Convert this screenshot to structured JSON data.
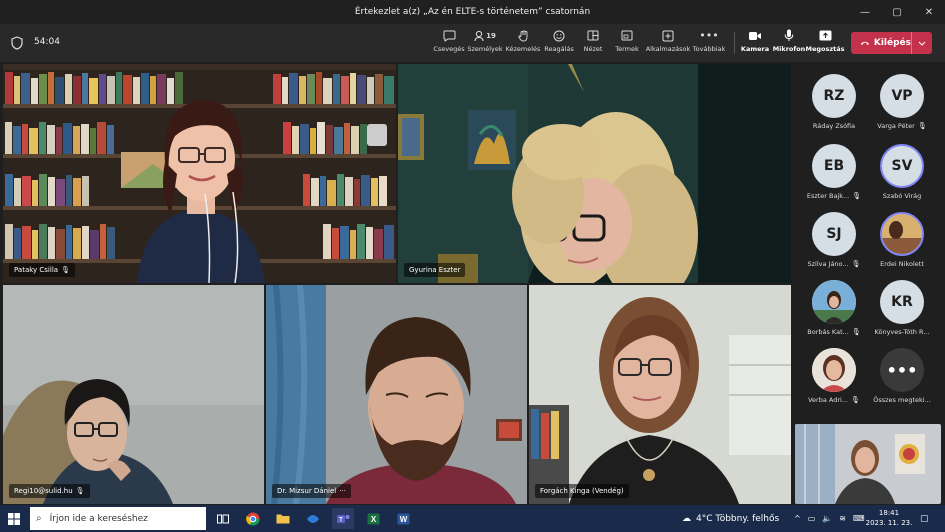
{
  "window": {
    "title": "Értekezlet a(z) „Az én ELTE-s történetem” csatornán",
    "minimize": "—",
    "maximize": "▢",
    "close": "✕"
  },
  "toolbar": {
    "timer": "54:04",
    "buttons": {
      "chat": "Csevegés",
      "people": "Személyek",
      "people_count": "19",
      "raise": "Kézemelés",
      "react": "Reagálás",
      "view": "Nézet",
      "rooms": "Termek",
      "apps": "Alkalmazások",
      "more": "Továbbiak",
      "camera": "Kamera",
      "mic": "Mikrofon",
      "share": "Megosztás"
    },
    "leave": "Kilépés"
  },
  "tiles": [
    {
      "name": "Pataky Csilla"
    },
    {
      "name": "Gyurina Eszter"
    },
    {
      "name": "Regi10@sulid.hu"
    },
    {
      "name": "Dr. Mizsur Dániel"
    },
    {
      "name": "Forgách Kinga (Vendég)"
    }
  ],
  "roster": [
    {
      "initials": "RZ",
      "name": "Ráday Zsófia"
    },
    {
      "initials": "VP",
      "name": "Varga Péter"
    },
    {
      "initials": "EB",
      "name": "Eszter Bajk..."
    },
    {
      "initials": "SV",
      "name": "Szabó Virág"
    },
    {
      "initials": "SJ",
      "name": "Szilva Jáno..."
    },
    {
      "initials": "",
      "name": "Erdei Nikolett"
    },
    {
      "initials": "",
      "name": "Borbás Kat..."
    },
    {
      "initials": "KR",
      "name": "Könyves-Tóth R..."
    },
    {
      "initials": "",
      "name": "Verba Adri..."
    },
    {
      "initials": "•••",
      "name": "Összes megteki..."
    }
  ],
  "taskbar": {
    "search_placeholder": "Írjon ide a kereséshez",
    "weather": "4°C  Többny. felhős",
    "time": "18:41",
    "date": "2023. 11. 23."
  },
  "colors": {
    "leave": "#c4314b",
    "ring": "#7f85f5",
    "taskbar": "#1a2a4a"
  }
}
